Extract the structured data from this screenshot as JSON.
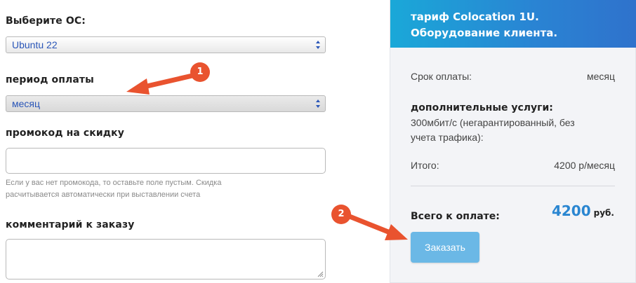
{
  "form": {
    "os_label": "Выберите ОС:",
    "os_value": "Ubuntu 22",
    "period_label": "период оплаты",
    "period_value": "месяц",
    "promo_label": "промокод на скидку",
    "promo_value": "",
    "promo_hint_line1": "Если у вас нет промокода, то оставьте поле пустым. Скидка",
    "promo_hint_line2": "расчитывается автоматически при выставлении счета",
    "comment_label": "комментарий к заказу",
    "comment_value": ""
  },
  "summary": {
    "title_line1": "тариф Colocation 1U.",
    "title_line2": "Оборудование клиента.",
    "term_label": "Срок оплаты:",
    "term_value": "месяц",
    "addons_label": "дополнительные услуги:",
    "addons_line1": "300мбит/с (негарантированный, без",
    "addons_line2": "учета трафика):",
    "subtotal_label": "Итого:",
    "subtotal_value": "4200 р/месяц",
    "total_label": "Всего к оплате:",
    "total_amount": "4200",
    "total_currency": "руб.",
    "order_button": "Заказать"
  },
  "annotations": {
    "badge1": "1",
    "badge2": "2",
    "color": "#e9532f"
  },
  "colors": {
    "accent_blue": "#2a86d1",
    "header_gradient_start": "#1aa8d8",
    "header_gradient_end": "#2f72cc",
    "button": "#6bb8e6",
    "select_text": "#2a56b8"
  }
}
